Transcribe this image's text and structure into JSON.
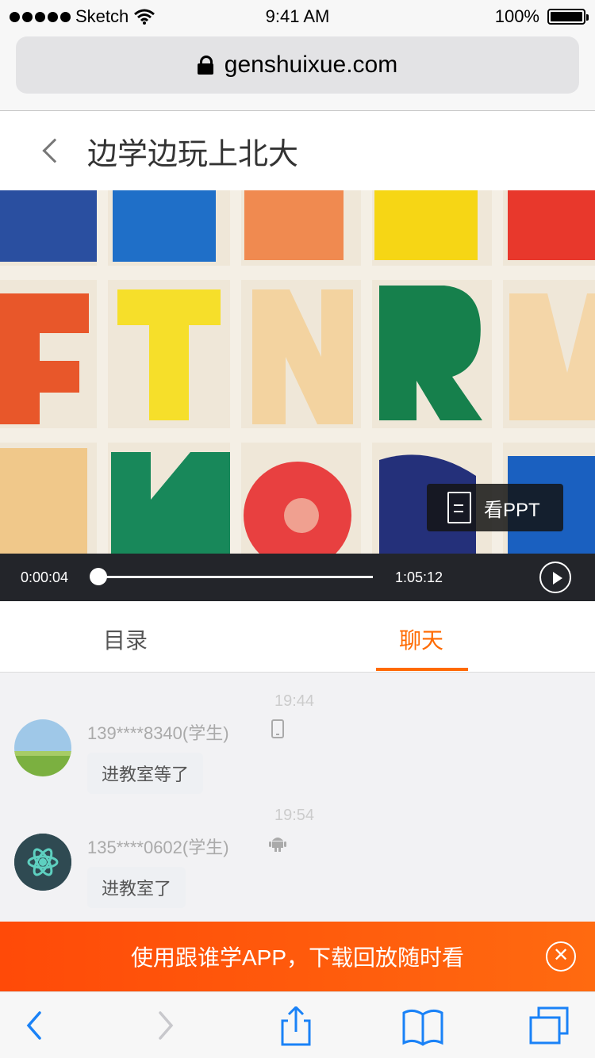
{
  "status_bar": {
    "carrier": "Sketch",
    "time": "9:41 AM",
    "battery": "100%"
  },
  "browser": {
    "url": "genshuixue.com"
  },
  "header": {
    "title": "边学边玩上北大"
  },
  "player": {
    "ppt_button": "看PPT",
    "elapsed": "0:00:04",
    "duration": "1:05:12",
    "progress": 0.01
  },
  "tabs": [
    {
      "label": "目录",
      "active": false
    },
    {
      "label": "聊天",
      "active": true
    }
  ],
  "chat": {
    "messages": [
      {
        "time": "19:44",
        "user": "139****8340(学生)",
        "device_icon": "phone-icon",
        "text": "进教室等了"
      },
      {
        "time": "19:54",
        "user": "135****0602(学生)",
        "device_icon": "android-icon",
        "text": "进教室了"
      }
    ]
  },
  "banner": {
    "text": "使用跟谁学APP，下载回放随时看"
  },
  "colors": {
    "accent": "#ff6a00",
    "banner": "#ff4a08",
    "ios_blue": "#1a82f7"
  }
}
